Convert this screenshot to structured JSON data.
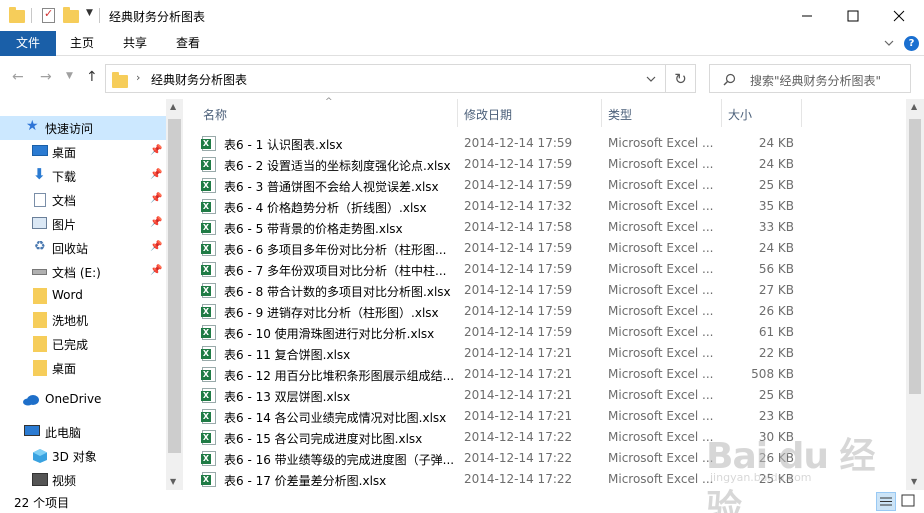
{
  "window": {
    "title": "经典财务分析图表"
  },
  "ribbon": {
    "tabs": [
      "文件",
      "主页",
      "共享",
      "查看"
    ]
  },
  "address": {
    "path": "经典财务分析图表",
    "search_placeholder": "搜索\"经典财务分析图表\""
  },
  "nav": {
    "items": [
      {
        "label": "快速访问",
        "icon": "star-icon"
      },
      {
        "label": "桌面",
        "icon": "desktop-icon"
      },
      {
        "label": "下载",
        "icon": "download-icon"
      },
      {
        "label": "文档",
        "icon": "document-icon"
      },
      {
        "label": "图片",
        "icon": "picture-icon"
      },
      {
        "label": "回收站",
        "icon": "recycle-bin-icon"
      },
      {
        "label": "文档 (E:)",
        "icon": "drive-icon"
      },
      {
        "label": "Word",
        "icon": "folder-icon"
      },
      {
        "label": "洗地机",
        "icon": "folder-icon"
      },
      {
        "label": "已完成",
        "icon": "folder-icon"
      },
      {
        "label": "桌面",
        "icon": "folder-icon"
      },
      {
        "label": "OneDrive",
        "icon": "cloud-icon"
      },
      {
        "label": "此电脑",
        "icon": "computer-icon"
      },
      {
        "label": "3D 对象",
        "icon": "cube-icon"
      },
      {
        "label": "视频",
        "icon": "video-icon"
      }
    ]
  },
  "columns": {
    "name": "名称",
    "date": "修改日期",
    "type": "类型",
    "size": "大小"
  },
  "files": [
    {
      "name": "表6 - 1 认识图表.xlsx",
      "date": "2014-12-14 17:59",
      "type": "Microsoft Excel ...",
      "size": "24 KB"
    },
    {
      "name": "表6 - 2 设置适当的坐标刻度强化论点.xlsx",
      "date": "2014-12-14 17:59",
      "type": "Microsoft Excel ...",
      "size": "24 KB"
    },
    {
      "name": "表6 - 3 普通饼图不会给人视觉误差.xlsx",
      "date": "2014-12-14 17:59",
      "type": "Microsoft Excel ...",
      "size": "25 KB"
    },
    {
      "name": "表6 - 4 价格趋势分析（折线图）.xlsx",
      "date": "2014-12-14 17:32",
      "type": "Microsoft Excel ...",
      "size": "35 KB"
    },
    {
      "name": "表6 - 5 带背景的价格走势图.xlsx",
      "date": "2014-12-14 17:58",
      "type": "Microsoft Excel ...",
      "size": "33 KB"
    },
    {
      "name": "表6 - 6 多项目多年份对比分析（柱形图...",
      "date": "2014-12-14 17:59",
      "type": "Microsoft Excel ...",
      "size": "24 KB"
    },
    {
      "name": "表6 - 7 多年份双项目对比分析（柱中柱...",
      "date": "2014-12-14 17:59",
      "type": "Microsoft Excel ...",
      "size": "56 KB"
    },
    {
      "name": "表6 - 8 带合计数的多项目对比分析图.xlsx",
      "date": "2014-12-14 17:59",
      "type": "Microsoft Excel ...",
      "size": "27 KB"
    },
    {
      "name": "表6 - 9 进销存对比分析（柱形图）.xlsx",
      "date": "2014-12-14 17:59",
      "type": "Microsoft Excel ...",
      "size": "26 KB"
    },
    {
      "name": "表6 - 10 使用滑珠图进行对比分析.xlsx",
      "date": "2014-12-14 17:59",
      "type": "Microsoft Excel ...",
      "size": "61 KB"
    },
    {
      "name": "表6 - 11 复合饼图.xlsx",
      "date": "2014-12-14 17:21",
      "type": "Microsoft Excel ...",
      "size": "22 KB"
    },
    {
      "name": "表6 - 12 用百分比堆积条形图展示组成结...",
      "date": "2014-12-14 17:21",
      "type": "Microsoft Excel ...",
      "size": "508 KB"
    },
    {
      "name": "表6 - 13 双层饼图.xlsx",
      "date": "2014-12-14 17:21",
      "type": "Microsoft Excel ...",
      "size": "25 KB"
    },
    {
      "name": "表6 - 14 各公司业绩完成情况对比图.xlsx",
      "date": "2014-12-14 17:21",
      "type": "Microsoft Excel ...",
      "size": "23 KB"
    },
    {
      "name": "表6 - 15 各公司完成进度对比图.xlsx",
      "date": "2014-12-14 17:22",
      "type": "Microsoft Excel ...",
      "size": "30 KB"
    },
    {
      "name": "表6 - 16 带业绩等级的完成进度图（子弹...",
      "date": "2014-12-14 17:22",
      "type": "Microsoft Excel ...",
      "size": "26 KB"
    },
    {
      "name": "表6 - 17 价差量差分析图.xlsx",
      "date": "2014-12-14 17:22",
      "type": "Microsoft Excel ...",
      "size": "25 KB"
    }
  ],
  "status": {
    "item_count": "22 个项目"
  },
  "watermark": {
    "logo": "Bai du 经验",
    "sub": "jingyan.baidu.com"
  },
  "colors": {
    "file_tab": "#1a5fa8",
    "selected": "#cce8ff",
    "folder": "#f6cd5a",
    "excel": "#1f7b45"
  }
}
